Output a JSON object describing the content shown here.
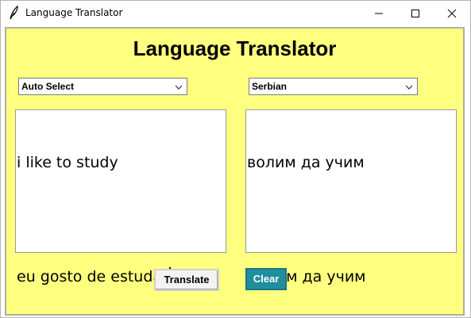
{
  "window": {
    "title": "Language Translator",
    "icon": "feather-icon"
  },
  "header": {
    "title": "Language Translator"
  },
  "source_language": {
    "selected": "Auto Select"
  },
  "target_language": {
    "selected": "Serbian"
  },
  "input_text": {
    "line1": "i like to study",
    "line2": "eu gosto de estudar"
  },
  "output_text": {
    "line1": "волим да учим",
    "line2": "Волим да учим"
  },
  "buttons": {
    "translate_label": "Translate",
    "clear_label": "Clear"
  },
  "colors": {
    "background": "#ffff80",
    "clear_button": "#1f8fa0"
  }
}
